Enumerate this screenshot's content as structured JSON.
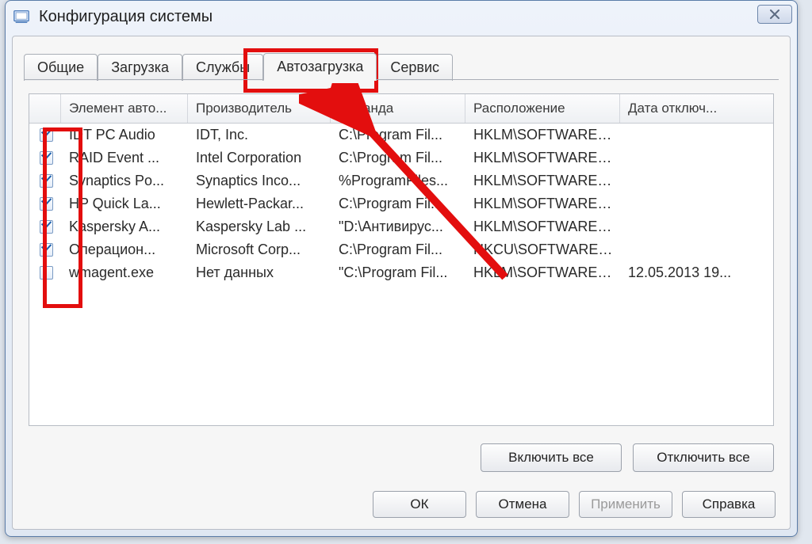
{
  "window": {
    "title": "Конфигурация системы"
  },
  "tabs": {
    "general": "Общие",
    "boot": "Загрузка",
    "services": "Службы",
    "startup": "Автозагрузка",
    "tools": "Сервис"
  },
  "columns": {
    "item": "Элемент авто...",
    "manufacturer": "Производитель",
    "command": "Команда",
    "location": "Расположение",
    "date": "Дата отключ..."
  },
  "rows": [
    {
      "checked": true,
      "item": "IDT PC Audio",
      "manufacturer": "IDT, Inc.",
      "command": "C:\\Program Fil...",
      "location": "HKLM\\SOFTWARE\\M...",
      "date": ""
    },
    {
      "checked": true,
      "item": "RAID Event ...",
      "manufacturer": "Intel Corporation",
      "command": "C:\\Program Fil...",
      "location": "HKLM\\SOFTWARE\\M...",
      "date": ""
    },
    {
      "checked": true,
      "item": "Synaptics Po...",
      "manufacturer": "Synaptics Inco...",
      "command": "%ProgramFiles...",
      "location": "HKLM\\SOFTWARE\\M...",
      "date": ""
    },
    {
      "checked": true,
      "item": "HP Quick La...",
      "manufacturer": "Hewlett-Packar...",
      "command": "C:\\Program Fil...",
      "location": "HKLM\\SOFTWARE\\M...",
      "date": ""
    },
    {
      "checked": true,
      "item": "Kaspersky A...",
      "manufacturer": "Kaspersky Lab ...",
      "command": "\"D:\\Антивирус...",
      "location": "HKLM\\SOFTWARE\\M...",
      "date": ""
    },
    {
      "checked": true,
      "item": "Операцион...",
      "manufacturer": "Microsoft Corp...",
      "command": "C:\\Program Fil...",
      "location": "HKCU\\SOFTWARE\\...",
      "date": ""
    },
    {
      "checked": false,
      "item": "wmagent.exe",
      "manufacturer": "Нет данных",
      "command": "\"C:\\Program Fil...",
      "location": "HKLM\\SOFTWARE\\M...",
      "date": "12.05.2013 19..."
    }
  ],
  "buttons": {
    "enable_all": "Включить все",
    "disable_all": "Отключить все",
    "ok": "ОК",
    "cancel": "Отмена",
    "apply": "Применить",
    "help": "Справка"
  }
}
